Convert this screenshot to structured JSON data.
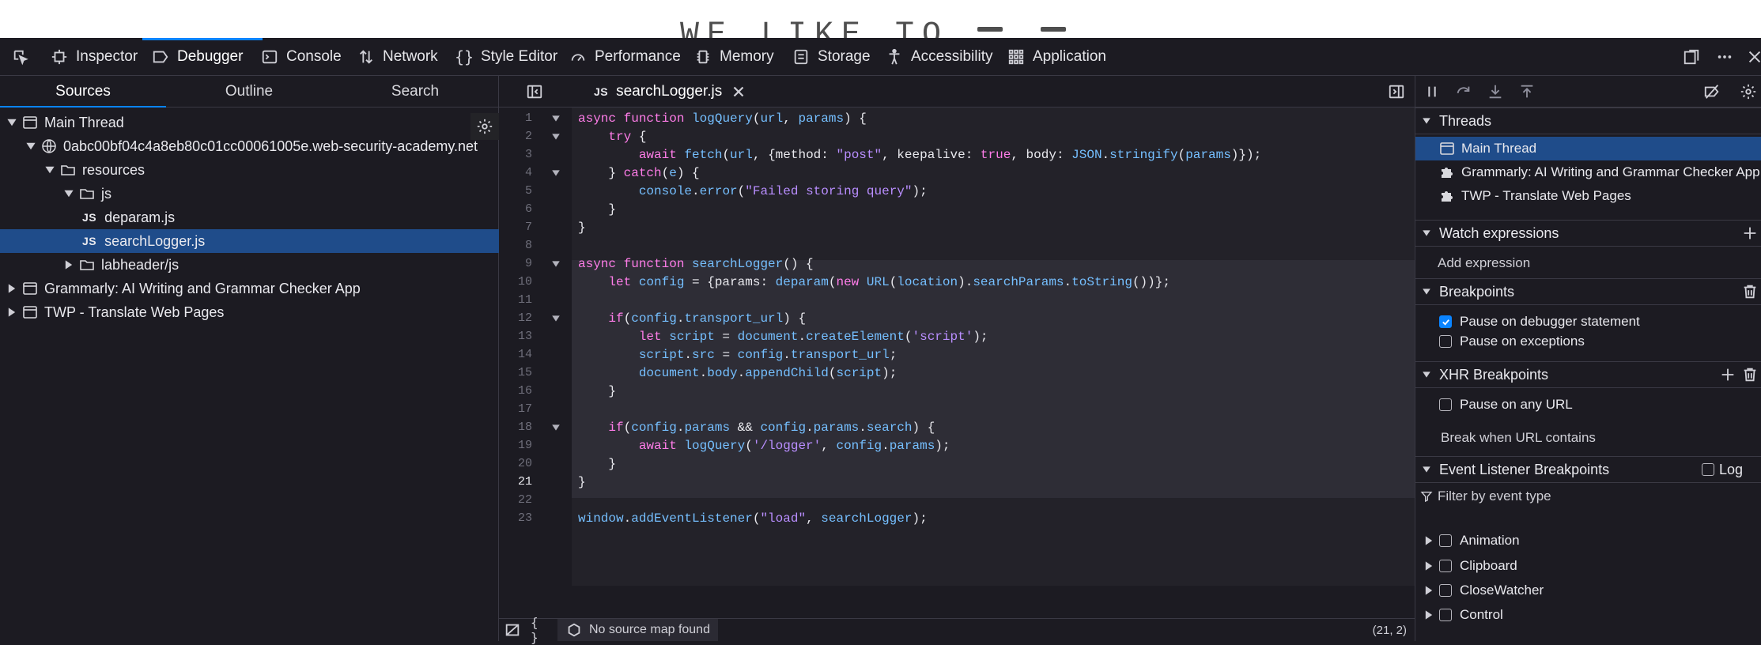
{
  "page_banner": {
    "text": "WE LIKE TO"
  },
  "toolbar": {
    "tabs": [
      {
        "label": "Inspector"
      },
      {
        "label": "Debugger"
      },
      {
        "label": "Console"
      },
      {
        "label": "Network"
      },
      {
        "label": "Style Editor"
      },
      {
        "label": "Performance"
      },
      {
        "label": "Memory"
      },
      {
        "label": "Storage"
      },
      {
        "label": "Accessibility"
      },
      {
        "label": "Application"
      }
    ],
    "active_tab": "Debugger"
  },
  "sources_panel": {
    "tabs": [
      "Sources",
      "Outline",
      "Search"
    ],
    "tree": [
      {
        "label": "Main Thread"
      },
      {
        "label": "0abc00bf04c4a8eb80c01cc00061005e.web-security-academy.net"
      },
      {
        "label": "resources"
      },
      {
        "label": "js"
      },
      {
        "label": "deparam.js",
        "badge": "JS"
      },
      {
        "label": "searchLogger.js",
        "badge": "JS"
      },
      {
        "label": "labheader/js"
      },
      {
        "label": "Grammarly: AI Writing and Grammar Checker App"
      },
      {
        "label": "TWP - Translate Web Pages"
      }
    ]
  },
  "editor": {
    "tab_badge": "JS",
    "tab_label": "searchLogger.js",
    "line_numbers": [
      "1",
      "2",
      "3",
      "4",
      "5",
      "6",
      "7",
      "8",
      "9",
      "10",
      "11",
      "12",
      "13",
      "14",
      "15",
      "16",
      "17",
      "18",
      "19",
      "20",
      "21",
      "22",
      "23"
    ],
    "status": {
      "source_map": "No source map found",
      "cursor": "(21, 2)"
    }
  },
  "right_panel": {
    "threads_title": "Threads",
    "threads": [
      "Main Thread",
      "Grammarly: AI Writing and Grammar Checker App",
      "TWP - Translate Web Pages"
    ],
    "watch_title": "Watch expressions",
    "watch_placeholder": "Add expression",
    "breakpoints_title": "Breakpoints",
    "breakpoints": [
      {
        "label": "Pause on debugger statement",
        "checked": true
      },
      {
        "label": "Pause on exceptions",
        "checked": false
      }
    ],
    "xhr_title": "XHR Breakpoints",
    "xhr_any": "Pause on any URL",
    "xhr_contains": "Break when URL contains",
    "event_title": "Event Listener Breakpoints",
    "event_log": "Log",
    "event_filter_placeholder": "Filter by event type",
    "events": [
      "Animation",
      "Clipboard",
      "CloseWatcher",
      "Control"
    ]
  },
  "colors": {
    "accent": "#0a84ff",
    "selection": "#1f4c8a",
    "keyword": "#ff7de9",
    "function": "#75bfff",
    "string": "#b98eff",
    "literal": "#86de74"
  }
}
